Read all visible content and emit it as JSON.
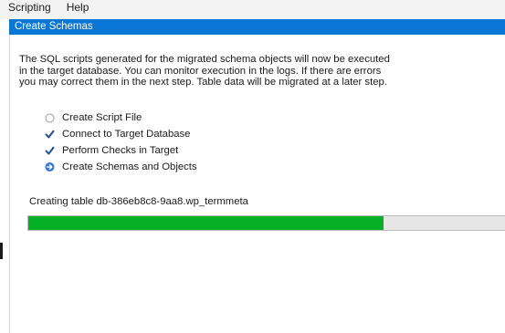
{
  "menu": {
    "items": [
      {
        "label": "Scripting"
      },
      {
        "label": "Help"
      }
    ]
  },
  "panel": {
    "title": "Create Schemas",
    "description_lines": [
      "The SQL scripts generated for the migrated schema objects will now be executed",
      "in the target database. You can monitor execution in the logs. If there are errors",
      "you may correct them in the next step. Table data will be migrated at a later step."
    ]
  },
  "steps": [
    {
      "label": "Create Script File",
      "state": "pending",
      "icon": "empty-radio-icon"
    },
    {
      "label": "Connect to Target Database",
      "state": "done",
      "icon": "checkmark-icon"
    },
    {
      "label": "Perform Checks in Target",
      "state": "done",
      "icon": "checkmark-icon"
    },
    {
      "label": "Create Schemas and Objects",
      "state": "in-progress",
      "icon": "arrow-right-icon"
    }
  ],
  "status": {
    "text": "Creating table db-386eb8c8-9aa8.wp_termmeta"
  },
  "progress": {
    "fraction": 0.745
  },
  "colors": {
    "header_bg": "#0a76d6",
    "progress_fill": "#06b025",
    "progress_track": "#e6e6e6",
    "check_color": "#1f4e8c",
    "arrow_circle": "#3a7bd5"
  }
}
